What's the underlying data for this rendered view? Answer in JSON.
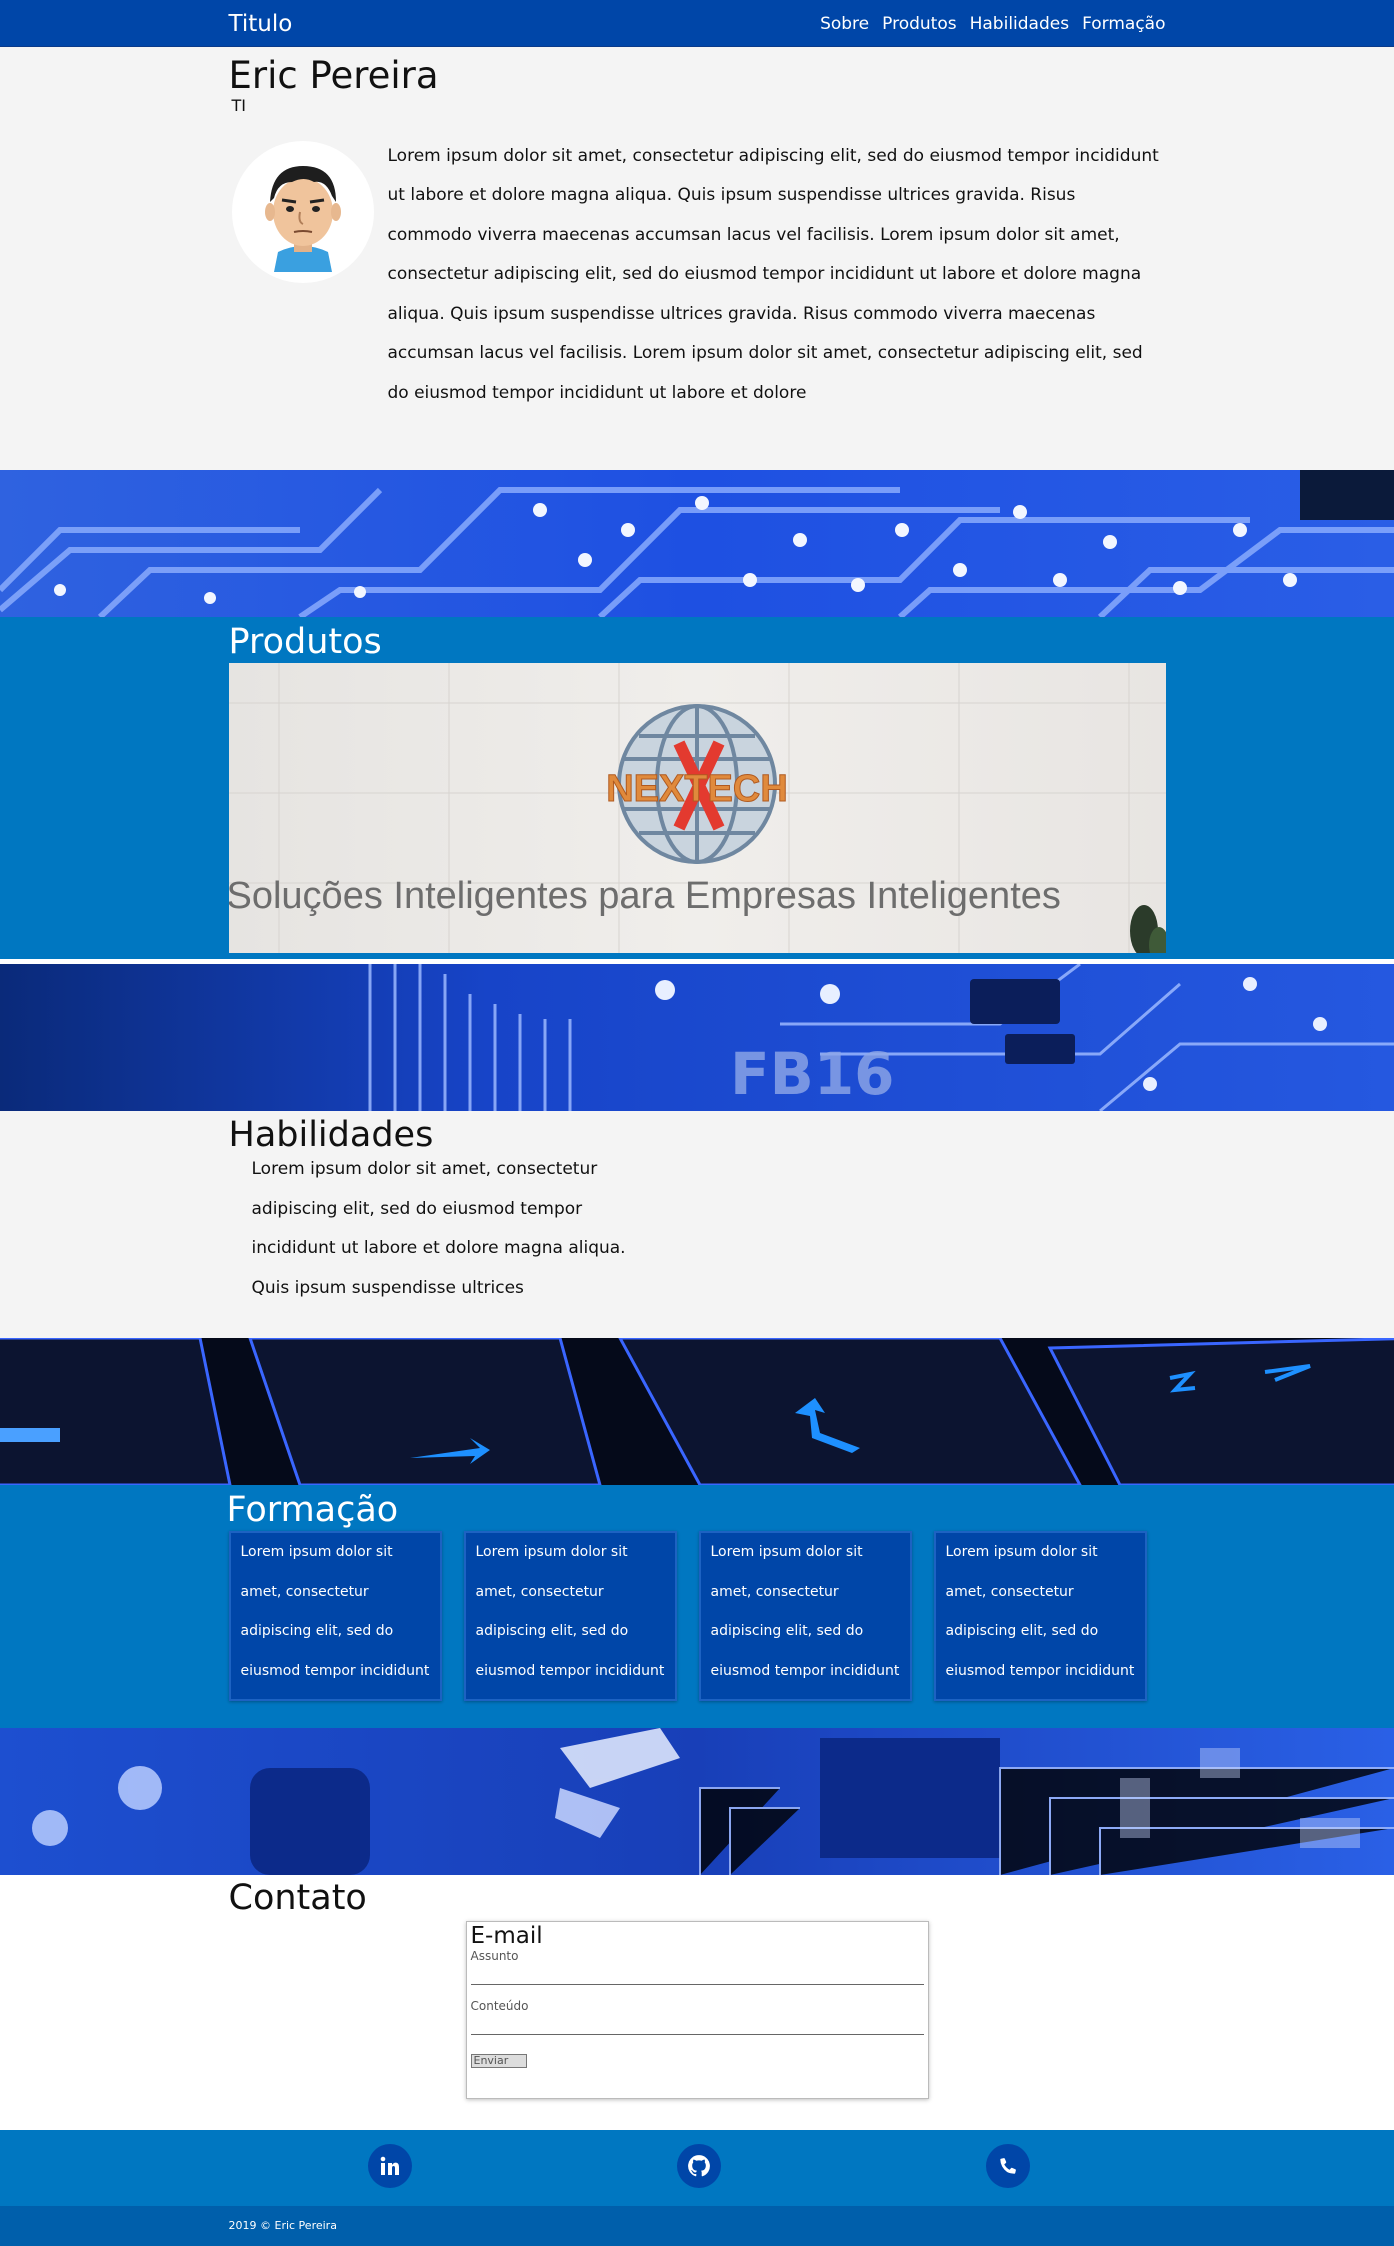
{
  "nav": {
    "brand": "Titulo",
    "links": [
      "Sobre",
      "Produtos",
      "Habilidades",
      "Formação"
    ]
  },
  "sobre": {
    "name": "Eric Pereira",
    "role": "TI",
    "text": "Lorem ipsum dolor sit amet, consectetur adipiscing elit, sed do eiusmod tempor incididunt ut labore et dolore magna aliqua. Quis ipsum suspendisse ultrices gravida. Risus commodo viverra maecenas accumsan lacus vel facilisis. Lorem ipsum dolor sit amet, consectetur adipiscing elit, sed do eiusmod tempor incididunt ut labore et dolore magna aliqua. Quis ipsum suspendisse ultrices gravida. Risus commodo viverra maecenas accumsan lacus vel facilisis. Lorem ipsum dolor sit amet, consectetur adipiscing elit, sed do eiusmod tempor incididunt ut labore et dolore"
  },
  "produtos": {
    "title": "Produtos",
    "logo_text": "NEXTECH",
    "tagline": "Soluções Inteligentes para Empresas Inteligentes"
  },
  "habilidades": {
    "title": "Habilidades",
    "text": "Lorem ipsum dolor sit amet, consectetur adipiscing elit, sed do eiusmod tempor incididunt ut labore et dolore magna aliqua. Quis ipsum suspendisse ultrices"
  },
  "formacao": {
    "title": "Formação",
    "cards": [
      "Lorem ipsum dolor sit amet, consectetur adipiscing elit, sed do eiusmod tempor incididunt",
      "Lorem ipsum dolor sit amet, consectetur adipiscing elit, sed do eiusmod tempor incididunt",
      "Lorem ipsum dolor sit amet, consectetur adipiscing elit, sed do eiusmod tempor incididunt",
      "Lorem ipsum dolor sit amet, consectetur adipiscing elit, sed do eiusmod tempor incididunt"
    ]
  },
  "banners": {
    "fb_label": "FB16"
  },
  "contato": {
    "title": "Contato",
    "form_title": "E-mail",
    "subject_label": "Assunto",
    "content_label": "Conteúdo",
    "submit_label": "Enviar"
  },
  "footer": {
    "icons": [
      "linkedin-icon",
      "github-icon",
      "phone-icon"
    ],
    "copyright": "2019 © Eric Pereira"
  },
  "colors": {
    "nav": "#0046a8",
    "section_blue": "#0077c1",
    "card_blue": "#0046a8",
    "light_bg": "#f4f4f4"
  }
}
